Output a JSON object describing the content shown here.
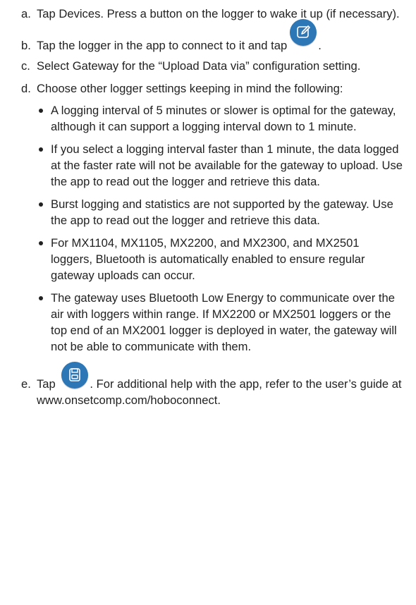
{
  "steps": {
    "a": {
      "letter": "a.",
      "text": "Tap Devices. Press a button on the logger to wake it up (if necessary)."
    },
    "b": {
      "letter": "b.",
      "text_before": "Tap the logger in the app to connect to it and tap",
      "text_after": ".",
      "icon": "edit-icon"
    },
    "c": {
      "letter": "c.",
      "text": "Select Gateway for the “Upload Data via” configuration setting."
    },
    "d": {
      "letter": "d.",
      "text": "Choose other logger settings keeping in mind the following:",
      "bullets": [
        "A logging interval of 5 minutes or slower is optimal for the gateway, although it can support a logging interval down to 1 minute.",
        "If you select a logging interval faster than 1 minute, the data logged at the faster rate will not be available for the gateway to upload. Use the app to read out the logger and retrieve this data.",
        "Burst logging and statistics are not supported by the gateway. Use the app to read out the logger and retrieve this data.",
        "For MX1104, MX1105, MX2200, and MX2300, and MX2501 loggers, Bluetooth is automatically enabled to ensure regular gateway uploads can occur.",
        "The gateway uses Bluetooth Low Energy to communicate over the air with loggers within range. If MX2200 or MX2501 loggers or the top end of an MX2001 logger is deployed in water, the gateway will not be able to communicate with them."
      ]
    },
    "e": {
      "letter": "e.",
      "text_before": "Tap",
      "text_after": ". For additional help with the app, refer to the user’s guide at www.onsetcomp.com/hoboconnect.",
      "icon": "save-icon"
    }
  },
  "colors": {
    "icon_background": "#2e77b7",
    "text": "#222222"
  }
}
